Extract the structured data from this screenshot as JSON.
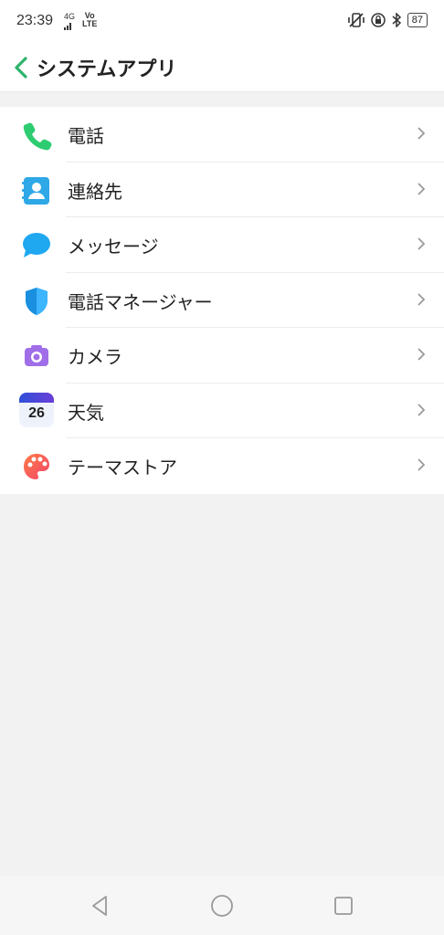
{
  "status": {
    "time": "23:39",
    "network": "4G",
    "volte_top": "Vo",
    "volte_bottom": "LTE",
    "battery": "87"
  },
  "header": {
    "title": "システムアプリ"
  },
  "items": [
    {
      "label": "電話",
      "icon": "phone-icon"
    },
    {
      "label": "連絡先",
      "icon": "contacts-icon"
    },
    {
      "label": "メッセージ",
      "icon": "messages-icon"
    },
    {
      "label": "電話マネージャー",
      "icon": "phone-manager-icon"
    },
    {
      "label": "カメラ",
      "icon": "camera-icon"
    },
    {
      "label": "天気",
      "icon": "weather-icon",
      "badge": "26"
    },
    {
      "label": "テーマストア",
      "icon": "theme-store-icon"
    }
  ],
  "colors": {
    "accent": "#2db36b",
    "background": "#f2f2f2"
  }
}
